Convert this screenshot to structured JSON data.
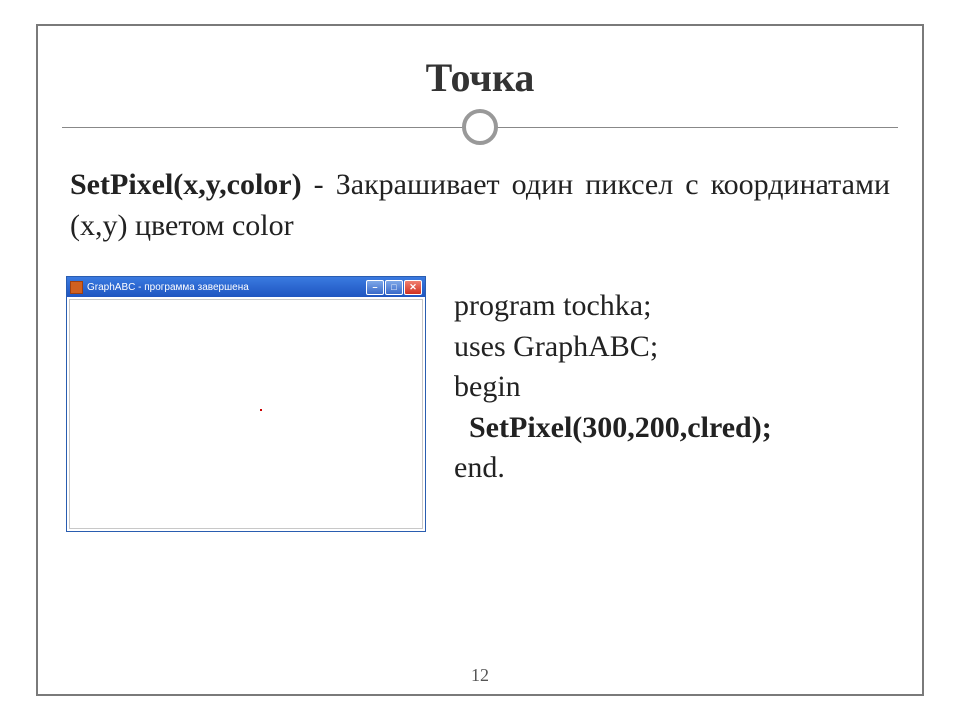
{
  "title": "Точка",
  "description": {
    "func": "SetPixel(x,y,color)",
    "sep": " - ",
    "text": "Закрашивает один пиксел с координатами (x,y) цветом color"
  },
  "window": {
    "title": "GraphABC - программа завершена",
    "controls": {
      "min": "–",
      "max": "□",
      "close": "✕"
    }
  },
  "code": {
    "l1": "program tochka;",
    "l2": "uses GraphABC;",
    "l3": "begin",
    "l4": "  SetPixel(300,200,clred);",
    "l5": "end."
  },
  "page": "12"
}
